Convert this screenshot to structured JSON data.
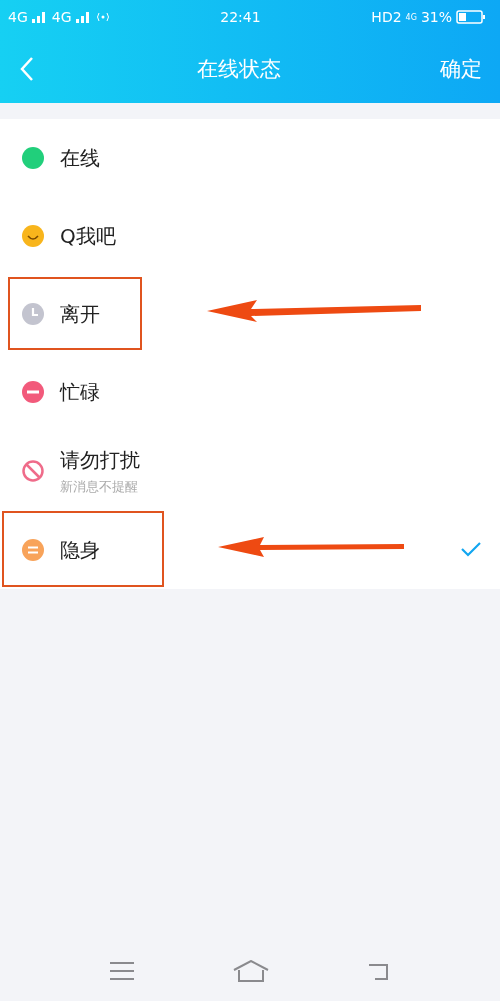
{
  "status_bar": {
    "network_1": "4G",
    "network_2": "4G",
    "time": "22:41",
    "hd": "HD2",
    "network_3": "4G",
    "battery": "31%"
  },
  "header": {
    "title": "在线状态",
    "action": "确定"
  },
  "statuses": [
    {
      "kind": "online",
      "label": "在线",
      "selected": false,
      "highlighted": false
    },
    {
      "kind": "qme",
      "label": "Q我吧",
      "selected": false,
      "highlighted": false
    },
    {
      "kind": "away",
      "label": "离开",
      "selected": false,
      "highlighted": true
    },
    {
      "kind": "busy",
      "label": "忙碌",
      "selected": false,
      "highlighted": false
    },
    {
      "kind": "dnd",
      "label": "请勿打扰",
      "subtitle": "新消息不提醒",
      "selected": false,
      "highlighted": false
    },
    {
      "kind": "invisible",
      "label": "隐身",
      "selected": true,
      "highlighted": true
    }
  ]
}
